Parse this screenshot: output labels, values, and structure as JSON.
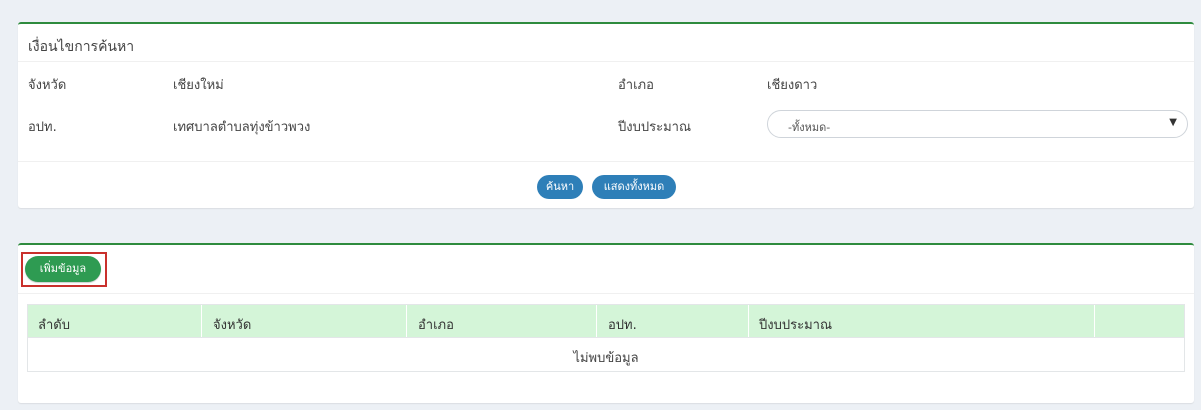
{
  "search_panel": {
    "title": "เงื่อนไขการค้นหา",
    "fields": {
      "province_label": "จังหวัด",
      "province_value": "เชียงใหม่",
      "district_label": "อำเภอ",
      "district_value": "เชียงดาว",
      "lao_label": "อปท.",
      "lao_value": "เทศบาลตำบลทุ่งข้าวพวง",
      "fiscal_year_label": "ปีงบประมาณ",
      "fiscal_year_selected": "-ทั้งหมด-"
    },
    "buttons": {
      "search": "ค้นหา",
      "show_all": "แสดงทั้งหมด"
    }
  },
  "result_panel": {
    "add_button": "เพิ่มข้อมูล",
    "table": {
      "columns": [
        "ลำดับ",
        "จังหวัด",
        "อำเภอ",
        "อปท.",
        "ปีงบประมาณ",
        ""
      ],
      "empty_message": "ไม่พบข้อมูล"
    }
  },
  "colors": {
    "panel_top_border": "#2e8b3e",
    "primary_button": "#2e7fb8",
    "add_button": "#2e9b52",
    "highlight": "#c9302c",
    "table_header_bg": "#d4f5d8",
    "page_bg": "#ecf0f5"
  },
  "icons": {
    "select_arrow": "caret-down-icon"
  }
}
